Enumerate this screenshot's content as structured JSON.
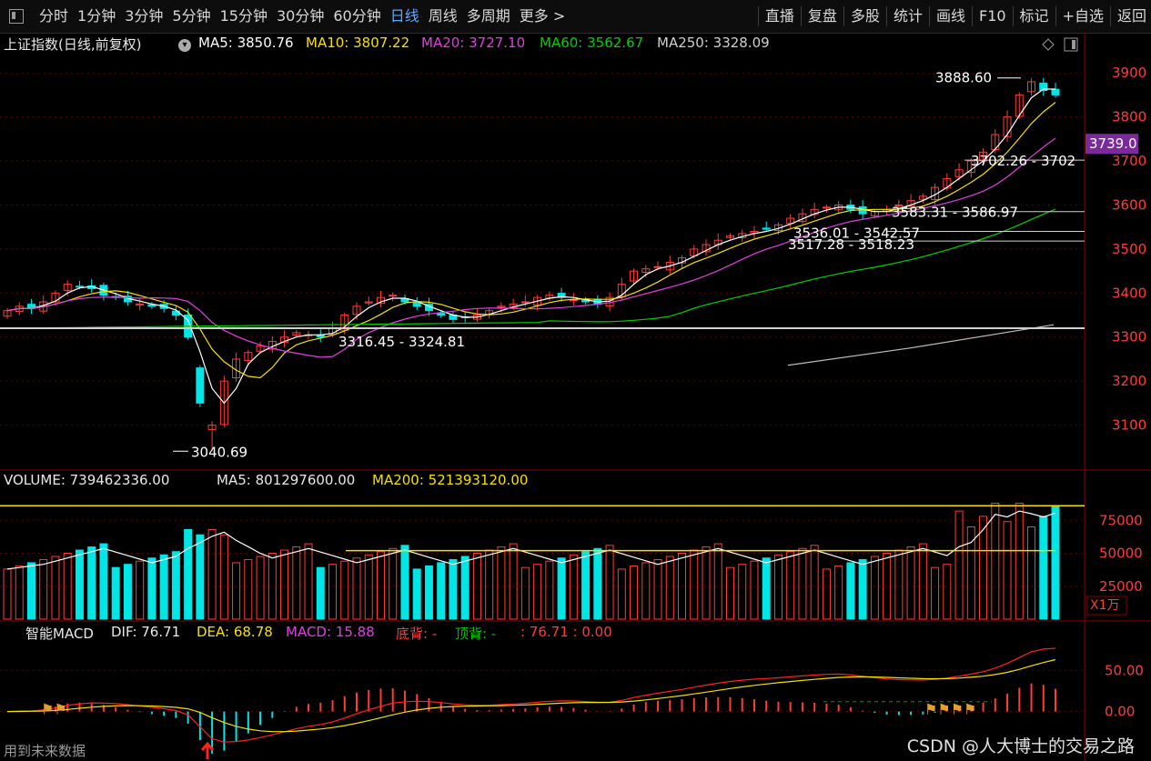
{
  "toolbar": {
    "left_items": [
      {
        "label": "分时",
        "active": false
      },
      {
        "label": "1分钟",
        "active": false
      },
      {
        "label": "3分钟",
        "active": false
      },
      {
        "label": "5分钟",
        "active": false
      },
      {
        "label": "15分钟",
        "active": false
      },
      {
        "label": "30分钟",
        "active": false
      },
      {
        "label": "60分钟",
        "active": false
      },
      {
        "label": "日线",
        "active": true
      },
      {
        "label": "周线",
        "active": false
      },
      {
        "label": "多周期",
        "active": false
      },
      {
        "label": "更多 >",
        "active": false
      }
    ],
    "right_items": [
      {
        "label": "直播"
      },
      {
        "label": "复盘"
      },
      {
        "label": "多股"
      },
      {
        "label": "统计"
      },
      {
        "label": "画线"
      },
      {
        "label": "F10"
      },
      {
        "label": "标记"
      },
      {
        "label": "+自选"
      },
      {
        "label": "返回"
      }
    ]
  },
  "main_panel": {
    "title": "上证指数(日线,前复权)",
    "ma5": "MA5: 3850.76",
    "ma10": "MA10: 3807.22",
    "ma20": "MA20: 3727.10",
    "ma60": "MA60: 3562.67",
    "ma250": "MA250: 3328.09",
    "current_price": "3739.0",
    "y_ticks": [
      "3900",
      "3800",
      "3700",
      "3600",
      "3500",
      "3400",
      "3300",
      "3200",
      "3100"
    ],
    "annotations": {
      "high": "3888.60",
      "low": "3040.69",
      "range1": "3702.26 - 3702",
      "range2": "3583.31 - 3586.97",
      "range3": "3536.01 - 3542.57",
      "range4": "3517.28 - 3518.23",
      "range5": "3316.45 - 3324.81"
    }
  },
  "volume_panel": {
    "volume": "VOLUME: 739462336.00",
    "ma5": "MA5: 801297600.00",
    "ma200": "MA200: 521393120.00",
    "y_ticks": [
      "75000",
      "50000",
      "25000"
    ],
    "unit": "X1万"
  },
  "macd_panel": {
    "title": "智能MACD",
    "dif": "DIF: 76.71",
    "dea": "DEA: 68.78",
    "macd": "MACD: 15.88",
    "bottom_div": "底背: -",
    "top_div": "顶背: -",
    "extra": ": 76.71 : 0.00",
    "y_ticks": [
      "50.00",
      "0.00"
    ]
  },
  "footer": {
    "left_text": "用到未来数据",
    "watermark": "CSDN @人大博士的交易之路"
  },
  "colors": {
    "up": "#ff3b3b",
    "down": "#00e5e5",
    "ma5": "#ffffff",
    "ma10": "#f5e000",
    "ma20": "#e040e0",
    "ma60": "#00d000",
    "ma250": "#bdbdbd",
    "price_tag": "#7a2a9a"
  },
  "chart_data": {
    "type": "candlestick",
    "panels": [
      "price",
      "volume",
      "macd"
    ],
    "price_ylim": [
      3000,
      3950
    ],
    "description_values": {
      "low_point": 3040.69,
      "high_point": 3888.6,
      "last_close_approx": 3850
    },
    "ohlc_sample_closes": [
      3360,
      3370,
      3365,
      3380,
      3400,
      3420,
      3415,
      3410,
      3395,
      3390,
      3380,
      3375,
      3370,
      3365,
      3350,
      3300,
      3150,
      3100,
      3200,
      3250,
      3265,
      3280,
      3290,
      3300,
      3310,
      3305,
      3300,
      3320,
      3350,
      3370,
      3380,
      3390,
      3395,
      3380,
      3370,
      3360,
      3350,
      3340,
      3345,
      3350,
      3360,
      3370,
      3375,
      3380,
      3390,
      3395,
      3390,
      3385,
      3380,
      3375,
      3390,
      3420,
      3450,
      3455,
      3460,
      3470,
      3480,
      3500,
      3510,
      3520,
      3530,
      3535,
      3540,
      3545,
      3555,
      3570,
      3580,
      3590,
      3595,
      3600,
      3590,
      3580,
      3585,
      3590,
      3600,
      3610,
      3620,
      3640,
      3660,
      3680,
      3700,
      3720,
      3760,
      3800,
      3850,
      3880,
      3860,
      3850
    ],
    "volume_ylim": [
      0,
      100000
    ],
    "macd_ylim": [
      -60,
      90
    ]
  }
}
